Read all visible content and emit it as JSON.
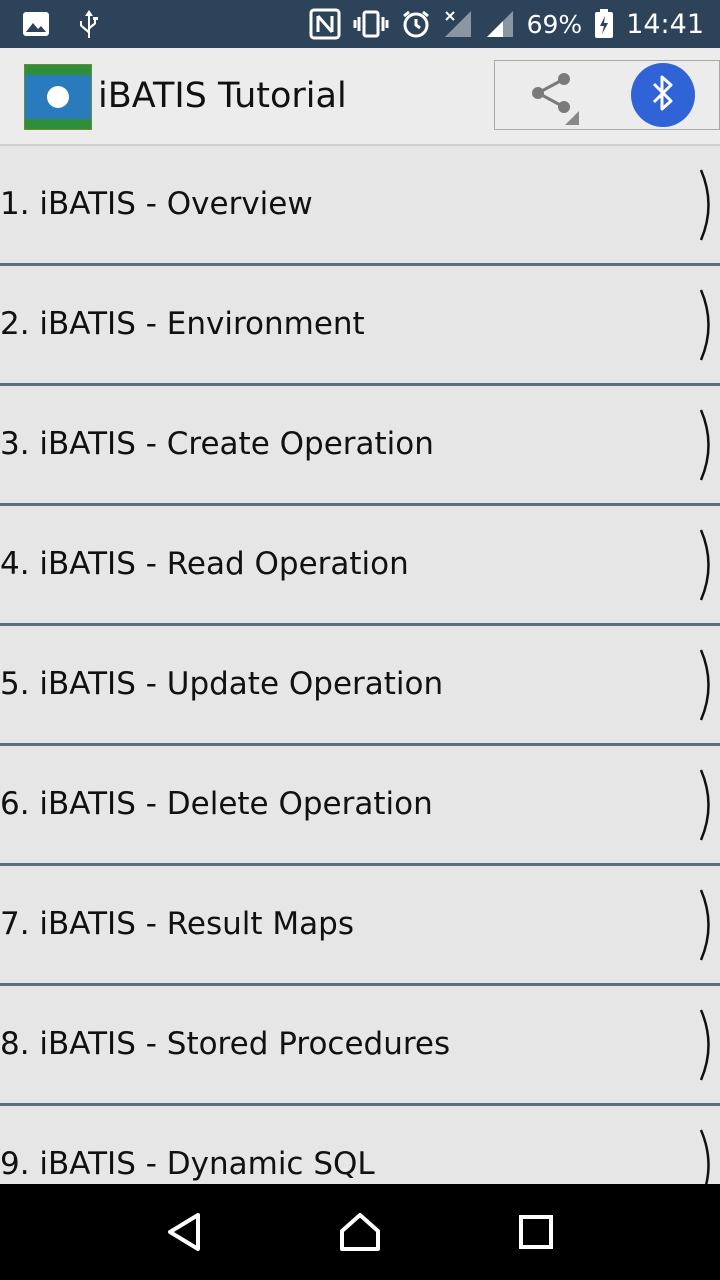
{
  "status_bar": {
    "battery": "69%",
    "time": "14:41",
    "icons": [
      "image-icon",
      "usb-icon",
      "nfc-icon",
      "vibrate-icon",
      "alarm-icon",
      "signal-x-icon",
      "signal-icon",
      "battery-charging-icon"
    ]
  },
  "app_bar": {
    "title": "iBATIS Tutorial",
    "logo": "ibatis-tutorial-logo",
    "actions": [
      "share-icon",
      "bluetooth-icon"
    ],
    "colors": {
      "bluetooth": "#2f63d6"
    }
  },
  "list": {
    "items": [
      {
        "label": "1. iBATIS - Overview"
      },
      {
        "label": "2. iBATIS - Environment"
      },
      {
        "label": "3. iBATIS - Create Operation"
      },
      {
        "label": "4. iBATIS - Read Operation"
      },
      {
        "label": "5. iBATIS - Update Operation"
      },
      {
        "label": "6. iBATIS - Delete Operation"
      },
      {
        "label": "7. iBATIS - Result Maps"
      },
      {
        "label": "8. iBATIS - Stored Procedures"
      },
      {
        "label": "9. iBATIS - Dynamic SQL"
      }
    ]
  },
  "nav_bar": {
    "buttons": [
      "back-icon",
      "home-icon",
      "recents-icon"
    ]
  }
}
